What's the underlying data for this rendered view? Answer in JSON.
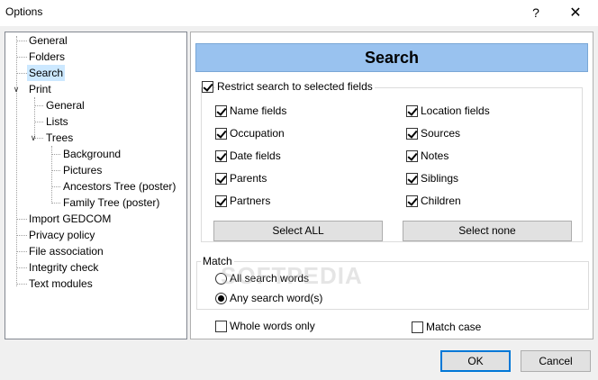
{
  "window": {
    "title": "Options",
    "help_glyph": "?",
    "close_glyph": "✕"
  },
  "tree": {
    "items": [
      {
        "label": "General"
      },
      {
        "label": "Folders"
      },
      {
        "label": "Search"
      },
      {
        "label": "Print"
      },
      {
        "label": "General"
      },
      {
        "label": "Lists"
      },
      {
        "label": "Trees"
      },
      {
        "label": "Background"
      },
      {
        "label": "Pictures"
      },
      {
        "label": "Ancestors Tree (poster)"
      },
      {
        "label": "Family Tree (poster)"
      },
      {
        "label": "Import GEDCOM"
      },
      {
        "label": "Privacy policy"
      },
      {
        "label": "File association"
      },
      {
        "label": "Integrity check"
      },
      {
        "label": "Text modules"
      }
    ],
    "selected_label": "Search"
  },
  "panel": {
    "title": "Search",
    "restrict": {
      "label": "Restrict search to selected fields",
      "checked": true
    },
    "fields_left": [
      {
        "label": "Name fields",
        "checked": true
      },
      {
        "label": "Occupation",
        "checked": true
      },
      {
        "label": "Date fields",
        "checked": true
      },
      {
        "label": "Parents",
        "checked": true
      },
      {
        "label": "Partners",
        "checked": true
      }
    ],
    "fields_right": [
      {
        "label": "Location fields",
        "checked": true
      },
      {
        "label": "Sources",
        "checked": true
      },
      {
        "label": "Notes",
        "checked": true
      },
      {
        "label": "Siblings",
        "checked": true
      },
      {
        "label": "Children",
        "checked": true
      }
    ],
    "select_all_label": "Select ALL",
    "select_none_label": "Select none",
    "match": {
      "legend": "Match",
      "options": [
        {
          "label": "All search words",
          "selected": false
        },
        {
          "label": "Any search word(s)",
          "selected": true
        }
      ]
    },
    "whole_words": {
      "label": "Whole words only",
      "checked": false
    },
    "match_case": {
      "label": "Match case",
      "checked": false
    }
  },
  "footer": {
    "ok_label": "OK",
    "cancel_label": "Cancel"
  },
  "watermark": "SOFTPEDIA"
}
